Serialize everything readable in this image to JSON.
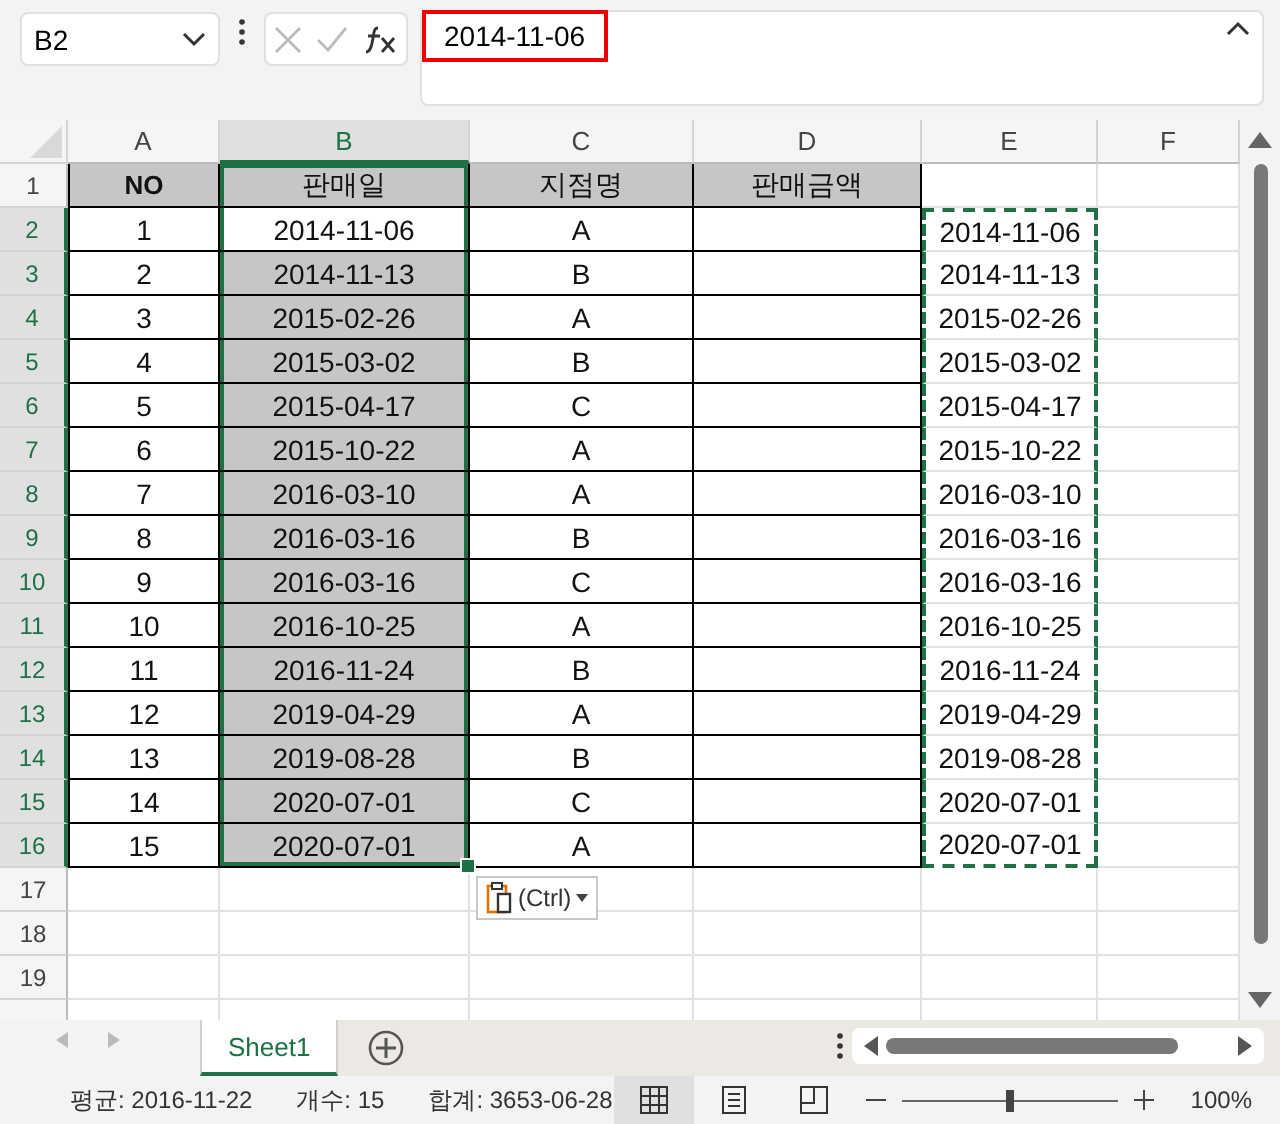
{
  "name_box": "B2",
  "formula": "2014-11-06",
  "column_headers": [
    {
      "label": "A",
      "selected": false
    },
    {
      "label": "B",
      "selected": true
    },
    {
      "label": "C",
      "selected": false
    },
    {
      "label": "D",
      "selected": false
    },
    {
      "label": "E",
      "selected": false
    },
    {
      "label": "F",
      "selected": false
    }
  ],
  "header_row": {
    "row": "1",
    "cells": [
      "NO",
      "판매일",
      "지점명",
      "판매금액"
    ]
  },
  "rows": [
    {
      "row": "2",
      "no": "1",
      "date": "2014-11-06",
      "branch": "A",
      "copied": "2014-11-06",
      "selected": true,
      "active": true
    },
    {
      "row": "3",
      "no": "2",
      "date": "2014-11-13",
      "branch": "B",
      "copied": "2014-11-13",
      "selected": true,
      "active": false
    },
    {
      "row": "4",
      "no": "3",
      "date": "2015-02-26",
      "branch": "A",
      "copied": "2015-02-26",
      "selected": true,
      "active": false
    },
    {
      "row": "5",
      "no": "4",
      "date": "2015-03-02",
      "branch": "B",
      "copied": "2015-03-02",
      "selected": true,
      "active": false
    },
    {
      "row": "6",
      "no": "5",
      "date": "2015-04-17",
      "branch": "C",
      "copied": "2015-04-17",
      "selected": true,
      "active": false
    },
    {
      "row": "7",
      "no": "6",
      "date": "2015-10-22",
      "branch": "A",
      "copied": "2015-10-22",
      "selected": true,
      "active": false
    },
    {
      "row": "8",
      "no": "7",
      "date": "2016-03-10",
      "branch": "A",
      "copied": "2016-03-10",
      "selected": true,
      "active": false
    },
    {
      "row": "9",
      "no": "8",
      "date": "2016-03-16",
      "branch": "B",
      "copied": "2016-03-16",
      "selected": true,
      "active": false
    },
    {
      "row": "10",
      "no": "9",
      "date": "2016-03-16",
      "branch": "C",
      "copied": "2016-03-16",
      "selected": true,
      "active": false
    },
    {
      "row": "11",
      "no": "10",
      "date": "2016-10-25",
      "branch": "A",
      "copied": "2016-10-25",
      "selected": true,
      "active": false
    },
    {
      "row": "12",
      "no": "11",
      "date": "2016-11-24",
      "branch": "B",
      "copied": "2016-11-24",
      "selected": true,
      "active": false
    },
    {
      "row": "13",
      "no": "12",
      "date": "2019-04-29",
      "branch": "A",
      "copied": "2019-04-29",
      "selected": true,
      "active": false
    },
    {
      "row": "14",
      "no": "13",
      "date": "2019-08-28",
      "branch": "B",
      "copied": "2019-08-28",
      "selected": true,
      "active": false
    },
    {
      "row": "15",
      "no": "14",
      "date": "2020-07-01",
      "branch": "C",
      "copied": "2020-07-01",
      "selected": true,
      "active": false
    },
    {
      "row": "16",
      "no": "15",
      "date": "2020-07-01",
      "branch": "A",
      "copied": "2020-07-01",
      "selected": true,
      "active": false
    }
  ],
  "empty_rows": [
    "17",
    "18",
    "19"
  ],
  "paste_options": "(Ctrl)",
  "sheet_tabs": [
    {
      "label": "Sheet1",
      "selected": true
    }
  ],
  "status": [
    "평균: 2016-11-22",
    "개수: 15",
    "합계: 3653-06-28"
  ],
  "views": [
    {
      "kind": "normal",
      "selected": true
    },
    {
      "kind": "page-layout",
      "selected": false
    },
    {
      "kind": "page-break",
      "selected": false
    }
  ],
  "zoom": {
    "level": 0.5,
    "reading": "100%"
  }
}
